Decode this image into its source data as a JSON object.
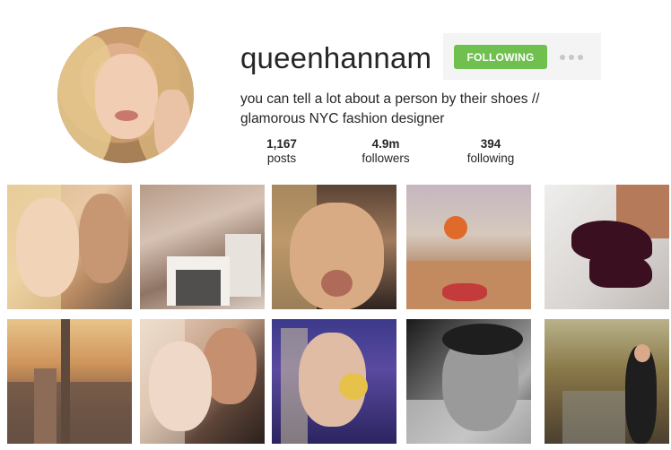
{
  "profile": {
    "username": "queenhannam",
    "follow_button_label": "FOLLOWING",
    "more_options_icon": "ellipsis-icon",
    "bio": {
      "line1": "you can tell a lot about a person by their shoes  //",
      "line2": "glamorous NYC fashion designer"
    },
    "stats": {
      "posts": {
        "count": "1,167",
        "label": "posts"
      },
      "followers": {
        "count": "4.9m",
        "label": "followers"
      },
      "following": {
        "count": "394",
        "label": "following"
      }
    }
  },
  "colors": {
    "follow_button": "#70c050",
    "follow_button_text": "#ffffff",
    "text": "#262626",
    "button_area_bg": "#f4f4f4"
  },
  "grid": {
    "rows": 2,
    "columns": 5,
    "photos": [
      "selfie-couple",
      "shopping-bags",
      "blonde-portrait",
      "food-table",
      "black-heels",
      "city-skyline",
      "two-women-selfie",
      "cupcake-portrait",
      "man-bw-portrait",
      "autumn-park"
    ]
  }
}
